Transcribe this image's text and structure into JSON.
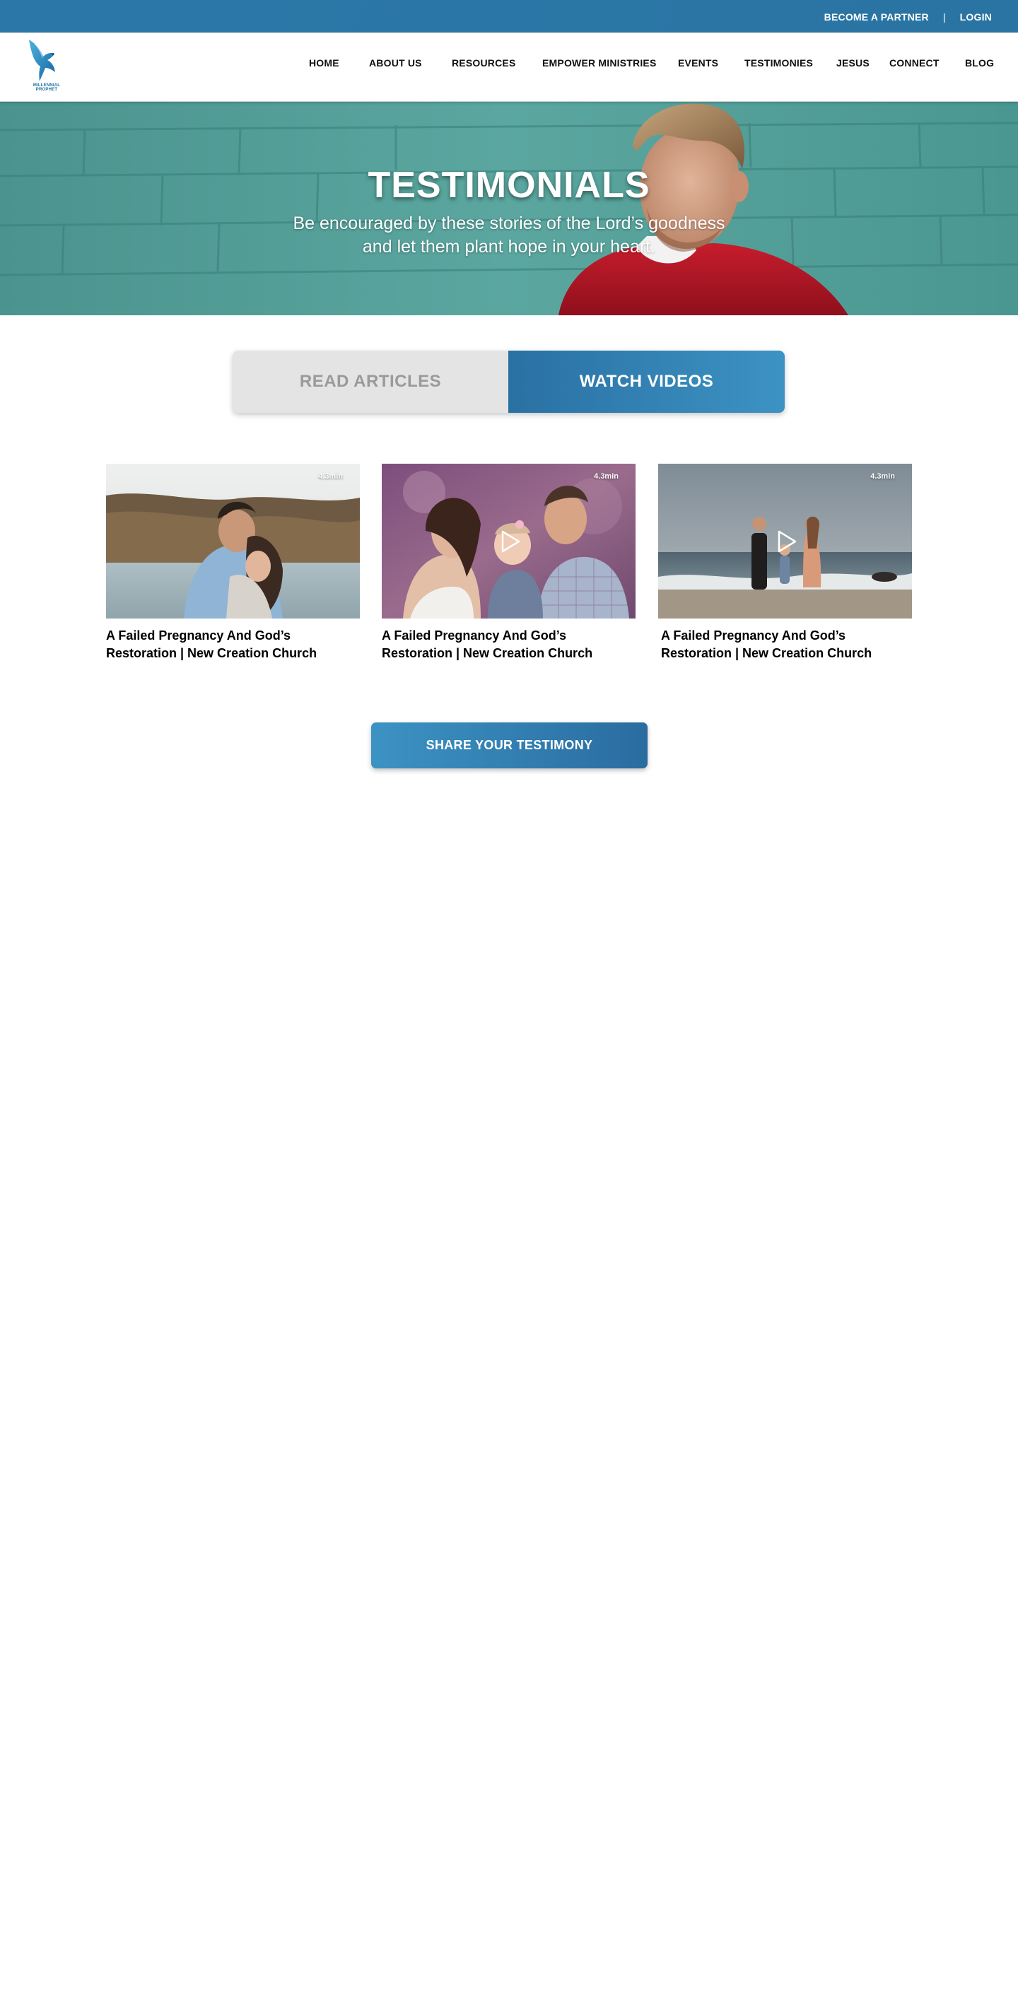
{
  "topbar": {
    "partner_label": "BECOME A PARTNER",
    "separator": "|",
    "login_label": "LOGIN"
  },
  "logo": {
    "text": "MILLENNIAL PROPHET",
    "icon": "dove-icon",
    "color": "#1e7fb5"
  },
  "nav": {
    "items": [
      {
        "label": "HOME"
      },
      {
        "label": "ABOUT US"
      },
      {
        "label": "RESOURCES"
      },
      {
        "label": "EMPOWER MINISTRIES"
      },
      {
        "label": "EVENTS"
      },
      {
        "label": "TESTIMONIES"
      },
      {
        "label": "JESUS"
      },
      {
        "label": "CONNECT"
      },
      {
        "label": "BLOG"
      }
    ]
  },
  "hero": {
    "title": "TESTIMONIALS",
    "subtitle_line1": "Be encouraged by these stories of the Lord’s goodness",
    "subtitle_line2": "and let them plant hope in your heart."
  },
  "tabs": {
    "articles_label": "READ ARTICLES",
    "videos_label": "WATCH VIDEOS",
    "active": "videos"
  },
  "videos": [
    {
      "duration": "4.3min",
      "title_line1": "A Failed Pregnancy And God’s",
      "title_line2": "Restoration | New Creation Church",
      "icon": "play-icon"
    },
    {
      "duration": "4.3min",
      "title_line1": "A Failed Pregnancy And God’s",
      "title_line2": "Restoration | New Creation Church",
      "icon": "play-icon"
    },
    {
      "duration": "4.3min",
      "title_line1": "A Failed Pregnancy And God’s",
      "title_line2": "Restoration | New Creation Church",
      "icon": "play-icon"
    }
  ],
  "cta": {
    "label": "SHARE YOUR TESTIMONY"
  },
  "colors": {
    "brand_blue": "#2b78a8",
    "tab_inactive": "#e4e4e4",
    "tab_inactive_text": "#9a9a9a"
  }
}
